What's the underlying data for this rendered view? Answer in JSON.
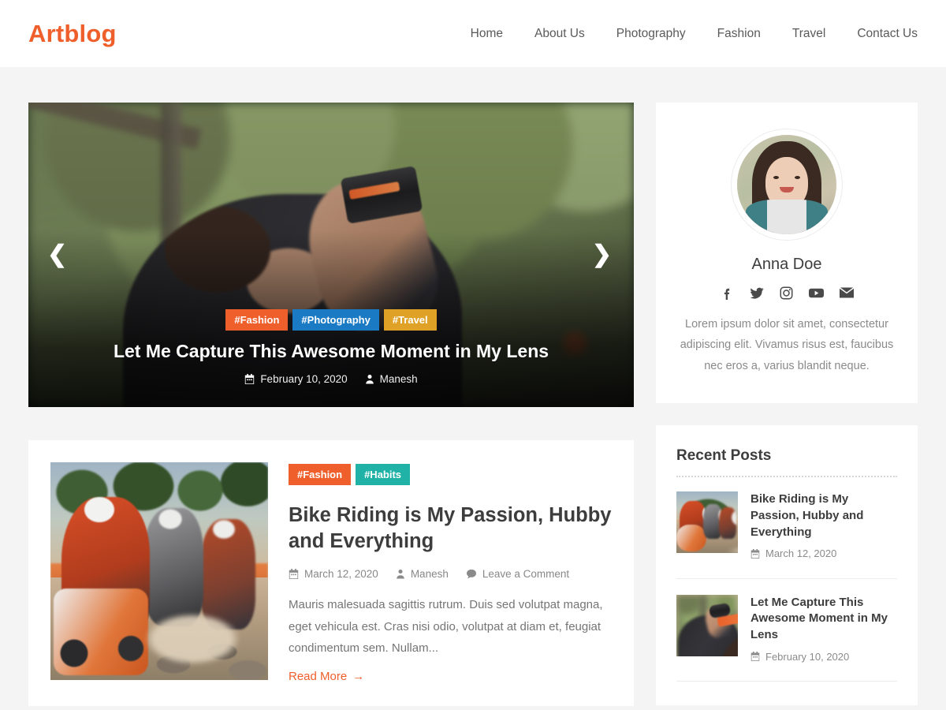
{
  "brand": {
    "name": "Artblog",
    "color": "#ef5f2c"
  },
  "nav": {
    "items": [
      {
        "label": "Home"
      },
      {
        "label": "About Us"
      },
      {
        "label": "Photography"
      },
      {
        "label": "Fashion"
      },
      {
        "label": "Travel"
      },
      {
        "label": "Contact Us"
      }
    ]
  },
  "hero": {
    "tags": [
      {
        "label": "#Fashion",
        "color": "#ef5f2c"
      },
      {
        "label": "#Photography",
        "color": "#1b7ac4"
      },
      {
        "label": "#Travel",
        "color": "#e0a226"
      }
    ],
    "title": "Let Me Capture This Awesome Moment in My Lens",
    "date": "February 10, 2020",
    "author": "Manesh",
    "prev_icon": "chevron-left-icon",
    "next_icon": "chevron-right-icon",
    "image_alt": "photographer-shooting-upward"
  },
  "post": {
    "tags": [
      {
        "label": "#Fashion",
        "color": "#ef5f2c"
      },
      {
        "label": "#Habits",
        "color": "#20b2a6"
      }
    ],
    "title": "Bike Riding is My Passion, Hubby and Everything",
    "date": "March 12, 2020",
    "author": "Manesh",
    "comments": "Leave a Comment",
    "excerpt": "Mauris malesuada sagittis rutrum. Duis sed volutpat magna, eget vehicula est. Cras nisi odio, volutpat at diam et, feugiat condimentum sem. Nullam...",
    "read_more": "Read More",
    "read_more_arrow": "→",
    "image_alt": "motocross-riders-on-rocky-terrain"
  },
  "sidebar": {
    "profile": {
      "name": "Anna Doe",
      "bio": "Lorem ipsum dolor sit amet, consectetur adipiscing elit. Vivamus risus est, faucibus nec eros a, varius blandit neque.",
      "avatar_alt": "smiling-woman-portrait",
      "socials": [
        {
          "name": "facebook-icon"
        },
        {
          "name": "twitter-icon"
        },
        {
          "name": "instagram-icon"
        },
        {
          "name": "youtube-icon"
        },
        {
          "name": "email-icon"
        }
      ]
    },
    "recent": {
      "title": "Recent Posts",
      "items": [
        {
          "title": "Bike Riding is My Passion, Hubby and Everything",
          "date": "March 12, 2020",
          "image_alt": "motocross-riders"
        },
        {
          "title": "Let Me Capture This Awesome Moment in My Lens",
          "date": "February 10, 2020",
          "image_alt": "photographer"
        }
      ]
    }
  },
  "icons": {
    "calendar": "calendar-icon",
    "author": "user-icon",
    "comment": "comment-icon"
  }
}
